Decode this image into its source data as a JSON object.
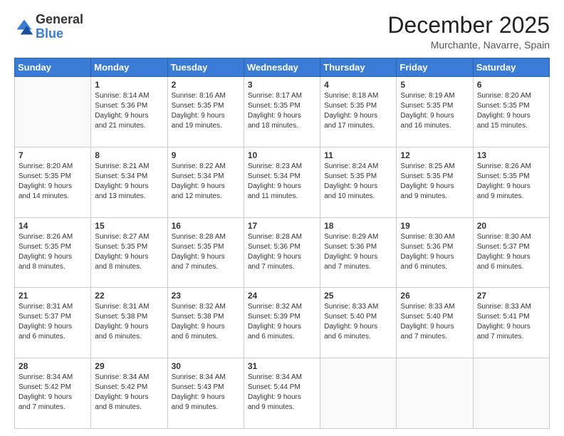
{
  "logo": {
    "general": "General",
    "blue": "Blue"
  },
  "header": {
    "month": "December 2025",
    "location": "Murchante, Navarre, Spain"
  },
  "days_of_week": [
    "Sunday",
    "Monday",
    "Tuesday",
    "Wednesday",
    "Thursday",
    "Friday",
    "Saturday"
  ],
  "weeks": [
    [
      {
        "day": "",
        "info": ""
      },
      {
        "day": "1",
        "info": "Sunrise: 8:14 AM\nSunset: 5:36 PM\nDaylight: 9 hours\nand 21 minutes."
      },
      {
        "day": "2",
        "info": "Sunrise: 8:16 AM\nSunset: 5:35 PM\nDaylight: 9 hours\nand 19 minutes."
      },
      {
        "day": "3",
        "info": "Sunrise: 8:17 AM\nSunset: 5:35 PM\nDaylight: 9 hours\nand 18 minutes."
      },
      {
        "day": "4",
        "info": "Sunrise: 8:18 AM\nSunset: 5:35 PM\nDaylight: 9 hours\nand 17 minutes."
      },
      {
        "day": "5",
        "info": "Sunrise: 8:19 AM\nSunset: 5:35 PM\nDaylight: 9 hours\nand 16 minutes."
      },
      {
        "day": "6",
        "info": "Sunrise: 8:20 AM\nSunset: 5:35 PM\nDaylight: 9 hours\nand 15 minutes."
      }
    ],
    [
      {
        "day": "7",
        "info": "Sunrise: 8:20 AM\nSunset: 5:35 PM\nDaylight: 9 hours\nand 14 minutes."
      },
      {
        "day": "8",
        "info": "Sunrise: 8:21 AM\nSunset: 5:34 PM\nDaylight: 9 hours\nand 13 minutes."
      },
      {
        "day": "9",
        "info": "Sunrise: 8:22 AM\nSunset: 5:34 PM\nDaylight: 9 hours\nand 12 minutes."
      },
      {
        "day": "10",
        "info": "Sunrise: 8:23 AM\nSunset: 5:34 PM\nDaylight: 9 hours\nand 11 minutes."
      },
      {
        "day": "11",
        "info": "Sunrise: 8:24 AM\nSunset: 5:35 PM\nDaylight: 9 hours\nand 10 minutes."
      },
      {
        "day": "12",
        "info": "Sunrise: 8:25 AM\nSunset: 5:35 PM\nDaylight: 9 hours\nand 9 minutes."
      },
      {
        "day": "13",
        "info": "Sunrise: 8:26 AM\nSunset: 5:35 PM\nDaylight: 9 hours\nand 9 minutes."
      }
    ],
    [
      {
        "day": "14",
        "info": "Sunrise: 8:26 AM\nSunset: 5:35 PM\nDaylight: 9 hours\nand 8 minutes."
      },
      {
        "day": "15",
        "info": "Sunrise: 8:27 AM\nSunset: 5:35 PM\nDaylight: 9 hours\nand 8 minutes."
      },
      {
        "day": "16",
        "info": "Sunrise: 8:28 AM\nSunset: 5:35 PM\nDaylight: 9 hours\nand 7 minutes."
      },
      {
        "day": "17",
        "info": "Sunrise: 8:28 AM\nSunset: 5:36 PM\nDaylight: 9 hours\nand 7 minutes."
      },
      {
        "day": "18",
        "info": "Sunrise: 8:29 AM\nSunset: 5:36 PM\nDaylight: 9 hours\nand 7 minutes."
      },
      {
        "day": "19",
        "info": "Sunrise: 8:30 AM\nSunset: 5:36 PM\nDaylight: 9 hours\nand 6 minutes."
      },
      {
        "day": "20",
        "info": "Sunrise: 8:30 AM\nSunset: 5:37 PM\nDaylight: 9 hours\nand 6 minutes."
      }
    ],
    [
      {
        "day": "21",
        "info": "Sunrise: 8:31 AM\nSunset: 5:37 PM\nDaylight: 9 hours\nand 6 minutes."
      },
      {
        "day": "22",
        "info": "Sunrise: 8:31 AM\nSunset: 5:38 PM\nDaylight: 9 hours\nand 6 minutes."
      },
      {
        "day": "23",
        "info": "Sunrise: 8:32 AM\nSunset: 5:38 PM\nDaylight: 9 hours\nand 6 minutes."
      },
      {
        "day": "24",
        "info": "Sunrise: 8:32 AM\nSunset: 5:39 PM\nDaylight: 9 hours\nand 6 minutes."
      },
      {
        "day": "25",
        "info": "Sunrise: 8:33 AM\nSunset: 5:40 PM\nDaylight: 9 hours\nand 6 minutes."
      },
      {
        "day": "26",
        "info": "Sunrise: 8:33 AM\nSunset: 5:40 PM\nDaylight: 9 hours\nand 7 minutes."
      },
      {
        "day": "27",
        "info": "Sunrise: 8:33 AM\nSunset: 5:41 PM\nDaylight: 9 hours\nand 7 minutes."
      }
    ],
    [
      {
        "day": "28",
        "info": "Sunrise: 8:34 AM\nSunset: 5:42 PM\nDaylight: 9 hours\nand 7 minutes."
      },
      {
        "day": "29",
        "info": "Sunrise: 8:34 AM\nSunset: 5:42 PM\nDaylight: 9 hours\nand 8 minutes."
      },
      {
        "day": "30",
        "info": "Sunrise: 8:34 AM\nSunset: 5:43 PM\nDaylight: 9 hours\nand 9 minutes."
      },
      {
        "day": "31",
        "info": "Sunrise: 8:34 AM\nSunset: 5:44 PM\nDaylight: 9 hours\nand 9 minutes."
      },
      {
        "day": "",
        "info": ""
      },
      {
        "day": "",
        "info": ""
      },
      {
        "day": "",
        "info": ""
      }
    ]
  ]
}
